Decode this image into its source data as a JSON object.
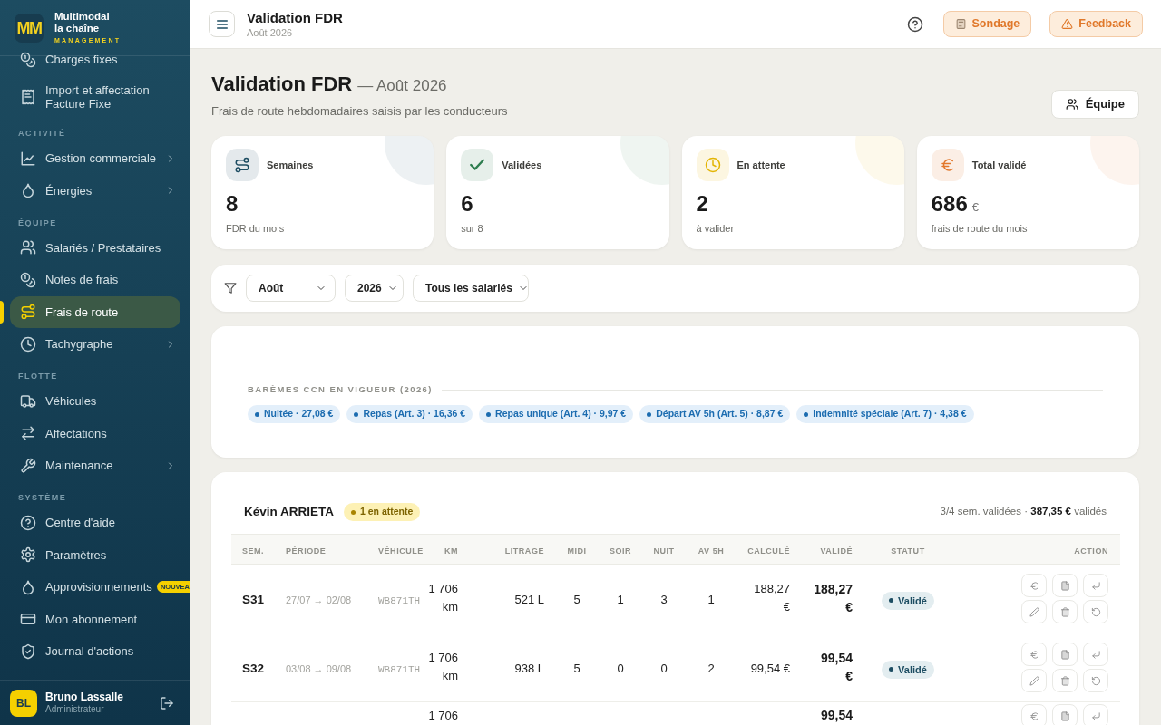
{
  "sidebar": {
    "brand": {
      "logo": "MM",
      "name": [
        "Multimodal",
        "la chaîne"
      ],
      "tagline": "MANAGEMENT"
    },
    "groups": [
      {
        "items": [
          {
            "label": "Charges fixes",
            "selected": false,
            "expandable": false
          },
          {
            "label": "Import et affectation Facture Fixe",
            "selected": false,
            "expandable": false
          }
        ]
      },
      {
        "heading": "ACTIVITÉ",
        "items": [
          {
            "label": "Gestion commerciale",
            "selected": false,
            "expandable": true
          },
          {
            "label": "Énergies",
            "selected": false,
            "expandable": true
          }
        ]
      },
      {
        "heading": "ÉQUIPE",
        "items": [
          {
            "label": "Salariés / Prestataires",
            "selected": false,
            "expandable": false
          },
          {
            "label": "Notes de frais",
            "selected": false,
            "expandable": false
          },
          {
            "label": "Frais de route",
            "selected": true,
            "expandable": false
          },
          {
            "label": "Tachygraphe",
            "selected": false,
            "expandable": true
          }
        ]
      },
      {
        "heading": "FLOTTE",
        "items": [
          {
            "label": "Véhicules",
            "selected": false,
            "expandable": false
          },
          {
            "label": "Affectations",
            "selected": false,
            "expandable": false
          },
          {
            "label": "Maintenance",
            "selected": false,
            "expandable": true
          }
        ]
      },
      {
        "heading": "SYSTÈME",
        "items": [
          {
            "label": "Centre d'aide",
            "selected": false,
            "expandable": false
          },
          {
            "label": "Paramètres",
            "selected": false,
            "expandable": false
          },
          {
            "label": "Approvisionnements",
            "selected": false,
            "expandable": false,
            "badge": "NOUVEA"
          },
          {
            "label": "Mon abonnement",
            "selected": false,
            "expandable": false
          },
          {
            "label": "Journal d'actions",
            "selected": false,
            "expandable": false
          }
        ]
      }
    ],
    "user": {
      "initials": "BL",
      "name": "Bruno Lassalle",
      "role": "Administrateur"
    }
  },
  "topbar": {
    "title": "Validation FDR",
    "subtitle": "Août 2026",
    "buttons": [
      {
        "label": "Sondage"
      },
      {
        "label": "Feedback"
      }
    ]
  },
  "page": {
    "title": "Validation FDR",
    "title_suffix": "— Août 2026",
    "description": "Frais de route hebdomadaires saisis par les conducteurs",
    "team_button": "Équipe"
  },
  "stats": [
    {
      "label": "Semaines",
      "value": "8",
      "note": "FDR du mois",
      "color": "#1e4d62"
    },
    {
      "label": "Validées",
      "value": "6",
      "note": "sur 8",
      "color": "#2e7d4f"
    },
    {
      "label": "En attente",
      "value": "2",
      "note": "à valider",
      "color": "#e3b505"
    },
    {
      "label": "Total validé",
      "value": "686",
      "unit": "€",
      "note": "frais de route du mois",
      "color": "#e2772b"
    }
  ],
  "filters": [
    {
      "value": "Août"
    },
    {
      "value": "2026"
    },
    {
      "value": "Tous les salariés"
    }
  ],
  "rates": {
    "heading": "BARÈMES CCN EN VIGUEUR (2026)",
    "items": [
      "Nuitée · 27,08 €",
      "Repas (Art. 3) · 16,36 €",
      "Repas unique (Art. 4) · 9,97 €",
      "Départ AV 5h (Art. 5) · 8,87 €",
      "Indemnité spéciale (Art. 7) · 4,38 €"
    ]
  },
  "employee": {
    "name": "Kévin ARRIETA",
    "badge": "1 en attente",
    "summary": "3/4 sem. validées · **387,35 €** validés"
  },
  "table": {
    "columns": [
      "SEM.",
      "PÉRIODE",
      "VÉHICULE",
      "KM",
      "LITRAGE",
      "MIDI",
      "SOIR",
      "NUIT",
      "AV 5H",
      "CALCULÉ",
      "VALIDÉ",
      "STATUT",
      "ACTION"
    ],
    "rows": [
      {
        "kind": "full",
        "week": "S31",
        "period": "27/07 → 02/08",
        "vehicle": "WB871TH",
        "km": "1 706 km",
        "fuel": "521 L",
        "midi": "5",
        "soir": "1",
        "nuit": "3",
        "av5h": "1",
        "calculated": "188,27 €",
        "validated": "188,27 €",
        "status": "Validé"
      },
      {
        "kind": "full",
        "week": "S32",
        "period": "03/08 → 09/08",
        "vehicle": "WB871TH",
        "km": "1 706 km",
        "fuel": "938 L",
        "midi": "5",
        "soir": "0",
        "nuit": "0",
        "av5h": "2",
        "calculated": "99,54 €",
        "validated": "99,54 €",
        "status": "Validé"
      },
      {
        "kind": "cut",
        "km": "1 706",
        "validated": "99,54"
      }
    ]
  }
}
